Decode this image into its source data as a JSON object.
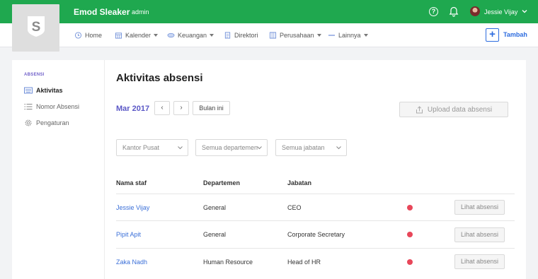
{
  "colors": {
    "brand_green": "#1fa84f",
    "accent_blue": "#2d6cdf",
    "month_purple": "#5a57c6",
    "status_red": "#e8475a"
  },
  "topbar": {
    "app_name": "Emod Sleaker",
    "role": "admin",
    "user_name": "Jessie Vijay",
    "help_glyph": "?"
  },
  "logo": {
    "letter": "S"
  },
  "nav": {
    "items": [
      {
        "label": "Home",
        "icon": "clock-icon",
        "has_dropdown": false
      },
      {
        "label": "Kalender",
        "icon": "calendar-icon",
        "has_dropdown": true
      },
      {
        "label": "Keuangan",
        "icon": "money-icon",
        "has_dropdown": true
      },
      {
        "label": "Direktori",
        "icon": "directory-icon",
        "has_dropdown": false
      },
      {
        "label": "Perusahaan",
        "icon": "building-icon",
        "has_dropdown": true
      },
      {
        "label": "Lainnya",
        "icon": "more-icon",
        "has_dropdown": true
      }
    ],
    "add_symbol": "+",
    "add_label": "Tambah"
  },
  "sidebar": {
    "heading": "ABSENSI",
    "items": [
      {
        "label": "Aktivitas",
        "icon": "keyboard-icon",
        "active": true
      },
      {
        "label": "Nomor Absensi",
        "icon": "list-icon",
        "active": false
      },
      {
        "label": "Pengaturan",
        "icon": "gear-icon",
        "active": false
      }
    ]
  },
  "main": {
    "title": "Aktivitas absensi",
    "month": "Mar 2017",
    "prev_glyph": "‹",
    "next_glyph": "›",
    "this_month_label": "Bulan ini",
    "upload_label": "Upload data absensi",
    "filters": {
      "branch": "Kantor Pusat",
      "department": "Semua departemen",
      "position": "Semua jabatan"
    },
    "table": {
      "headers": [
        "Nama staf",
        "Departemen",
        "Jabatan"
      ],
      "action_label": "Lihat absensi",
      "rows": [
        {
          "name": "Jessie Vijay",
          "department": "General",
          "position": "CEO"
        },
        {
          "name": "Pipit Apit",
          "department": "General",
          "position": "Corporate Secretary"
        },
        {
          "name": "Zaka Nadh",
          "department": "Human Resource",
          "position": "Head of HR"
        }
      ]
    }
  }
}
